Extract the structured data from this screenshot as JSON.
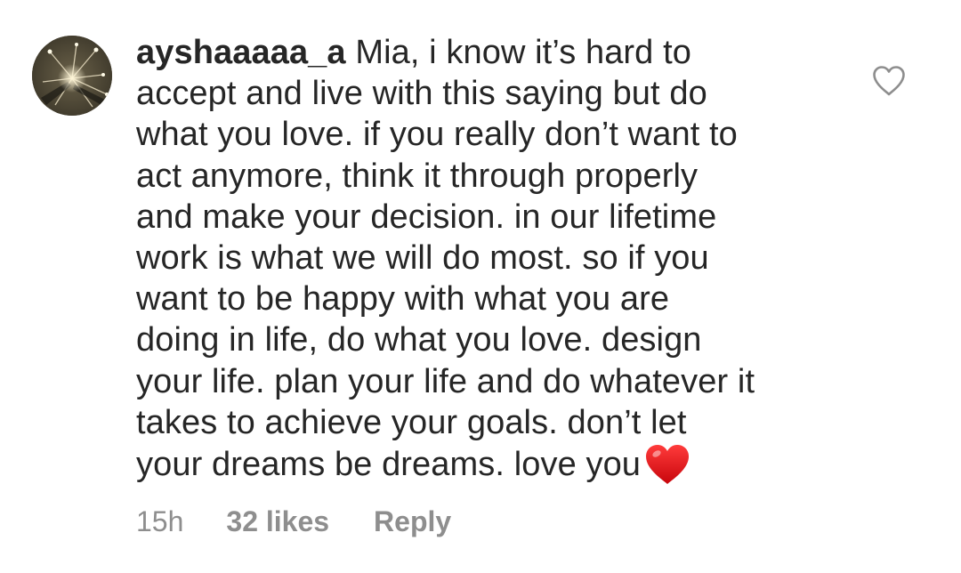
{
  "comment": {
    "username": "ayshaaaaa_a",
    "text": "Mia, i know it’s hard to\naccept and live with this saying but do\nwhat you love. if you really don’t want to\nact anymore, think it through properly\nand make your decision. in our lifetime\nwork is what we will do most. so if you\nwant to be happy with what you are\ndoing in life, do what you love. design\nyour life. plan your life and do whatever it\ntakes to achieve your goals. don’t let\nyour dreams be dreams. love you",
    "emoji": "red-heart",
    "time": "15h",
    "likes": "32 likes",
    "reply_label": "Reply"
  },
  "colors": {
    "text": "#262626",
    "meta": "#8e8e8e",
    "heart_emoji": "#e0161c",
    "like_icon_stroke": "#8e8e8e"
  },
  "icons": {
    "avatar": "profile-photo",
    "like": "heart-outline-icon",
    "emoji": "red-heart-emoji"
  }
}
